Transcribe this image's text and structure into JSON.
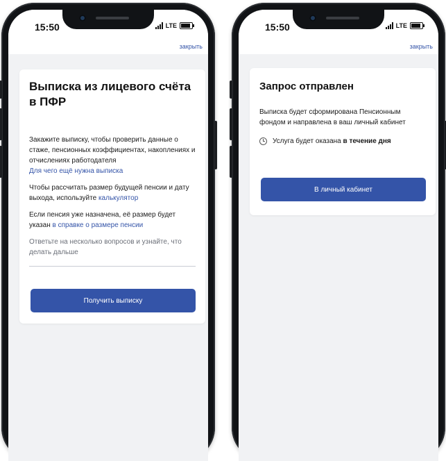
{
  "status": {
    "time": "15:50",
    "network": "LTE"
  },
  "left": {
    "close": "закрыть",
    "title": "Выписка из лицевого счёта в ПФР",
    "p1": "Закажите выписку, чтобы проверить данные о стаже, пенсионных коэффициентах, накоплениях и отчислениях работодателя",
    "p1_link": "Для чего ещё нужна выписка",
    "p2": "Чтобы рассчитать размер будущей пенсии и дату выхода, используйте",
    "p2_link": "калькулятор",
    "p3": "Если пенсия уже назначена, её размер будет указан",
    "p3_link": "в справке о размере пенсии",
    "p4": "Ответьте на несколько вопросов и узнайте, что делать дальше",
    "button": "Получить выписку"
  },
  "right": {
    "close": "закрыть",
    "title": "Запрос отправлен",
    "p1": "Выписка будет сформирована Пенсионным фондом и направлена в ваш личный кабинет",
    "info_prefix": "Услуга будет оказана",
    "info_bold": "в течение дня",
    "button": "В личный кабинет"
  }
}
